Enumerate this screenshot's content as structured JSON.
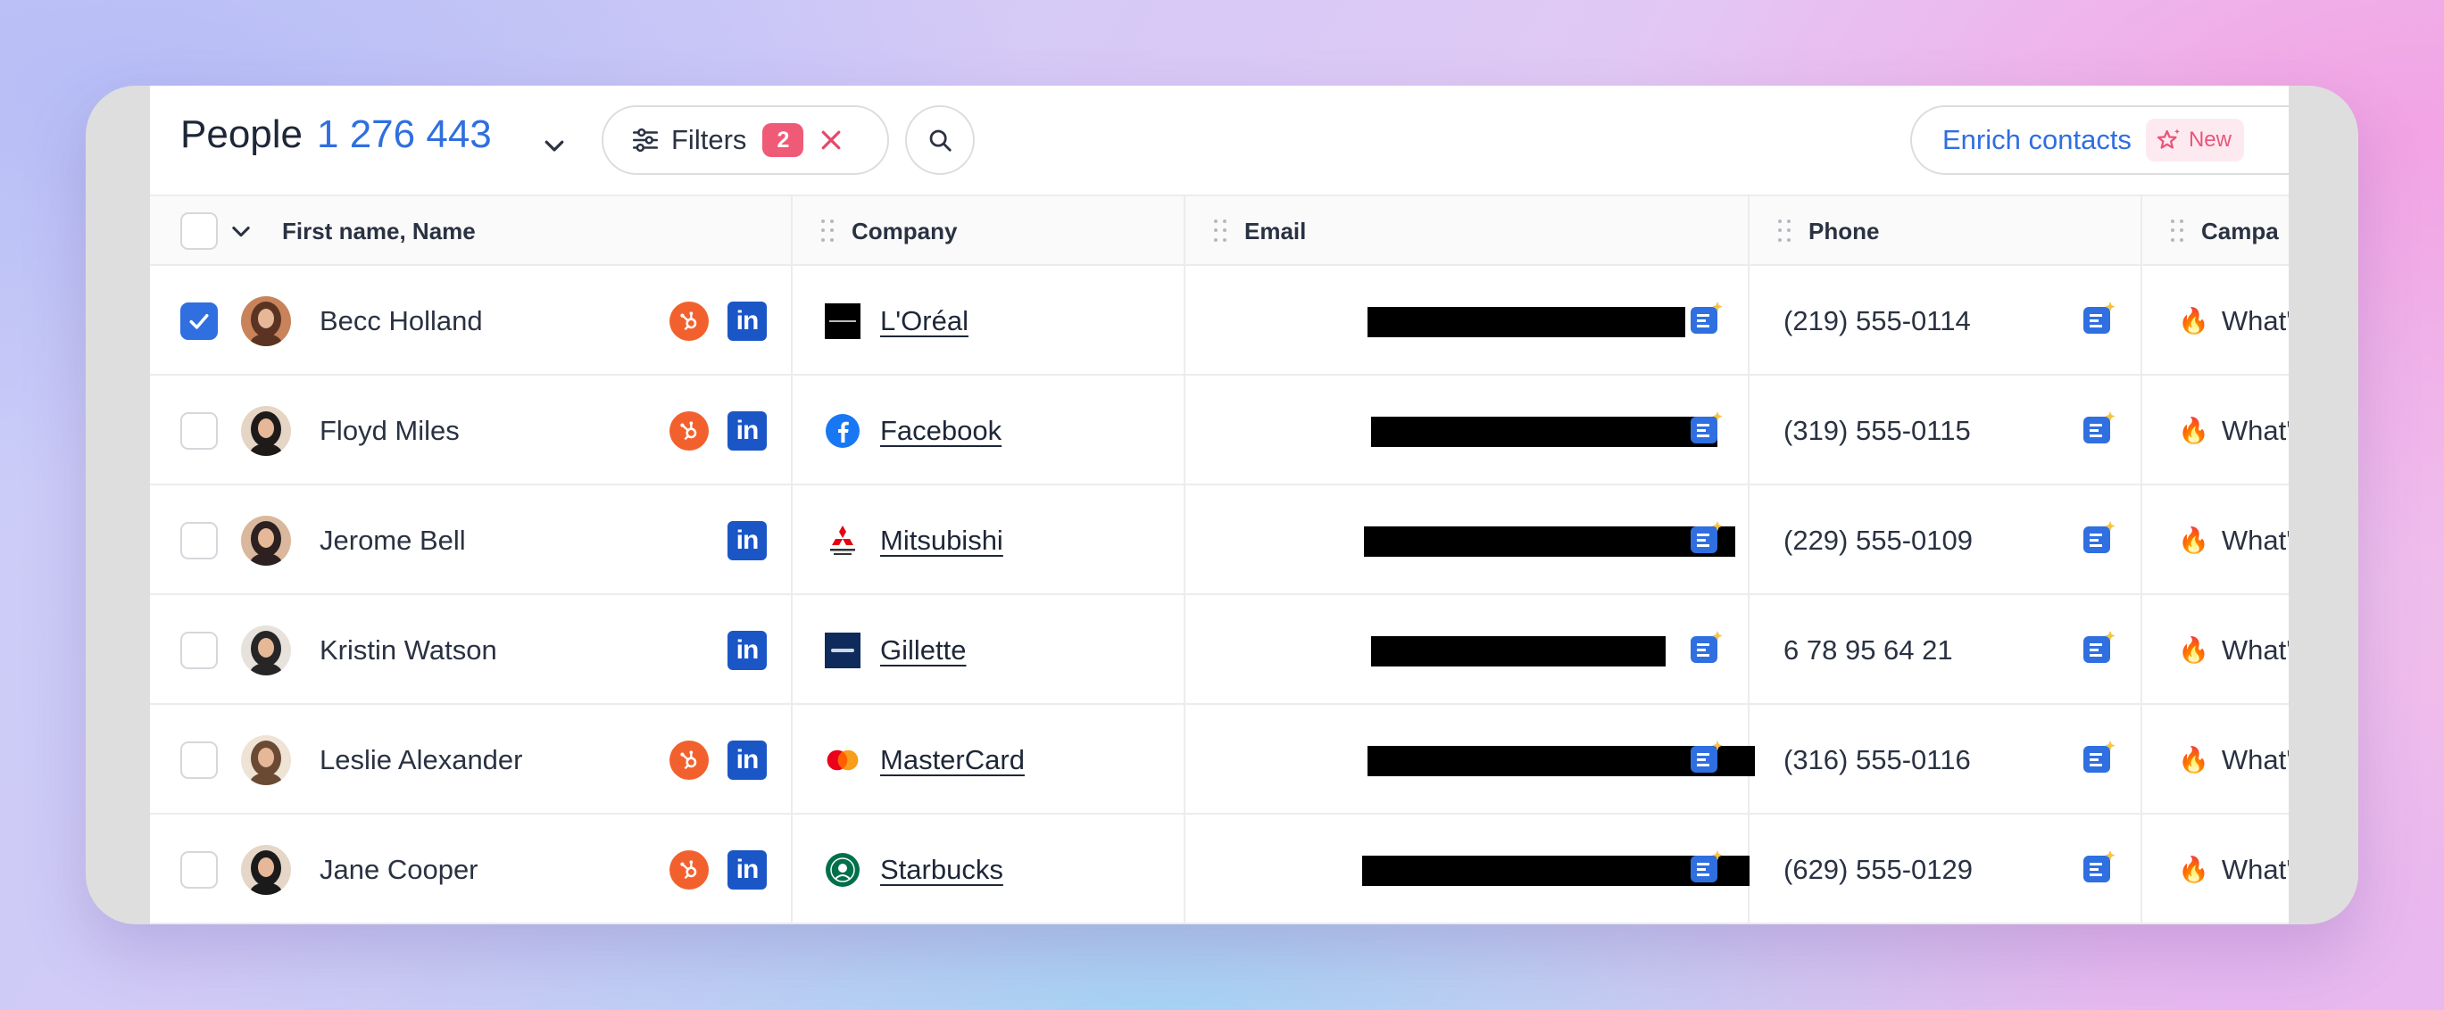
{
  "header": {
    "title": "People",
    "count": "1 276 443",
    "filters_label": "Filters",
    "filters_count": "2",
    "enrich_label": "Enrich contacts",
    "new_tag": "New"
  },
  "columns": {
    "name": "First name, Name",
    "company": "Company",
    "email": "Email",
    "phone": "Phone",
    "campaign": "Campa"
  },
  "rows": [
    {
      "name": "Becc Holland",
      "checked": true,
      "hubspot": true,
      "linkedin": true,
      "company": "L'Oréal",
      "company_logo": "loreal-logo",
      "email": "",
      "phone": "(219) 555-0114",
      "campaign": "What'"
    },
    {
      "name": "Floyd Miles",
      "checked": false,
      "hubspot": true,
      "linkedin": true,
      "company": "Facebook",
      "company_logo": "facebook-logo",
      "email": "",
      "phone": "(319) 555-0115",
      "campaign": "What'"
    },
    {
      "name": "Jerome Bell",
      "checked": false,
      "hubspot": false,
      "linkedin": true,
      "company": "Mitsubishi",
      "company_logo": "mitsubishi-logo",
      "email": "",
      "phone": "(229) 555-0109",
      "campaign": "What'"
    },
    {
      "name": "Kristin Watson",
      "checked": false,
      "hubspot": false,
      "linkedin": true,
      "company": "Gillette",
      "company_logo": "gillette-logo",
      "email": "",
      "phone": "6 78 95 64 21",
      "campaign": "What'"
    },
    {
      "name": "Leslie Alexander",
      "checked": false,
      "hubspot": true,
      "linkedin": true,
      "company": "MasterCard",
      "company_logo": "mastercard-logo",
      "email": "",
      "phone": "(316) 555-0116",
      "campaign": "What'"
    },
    {
      "name": "Jane Cooper",
      "checked": false,
      "hubspot": true,
      "linkedin": true,
      "company": "Starbucks",
      "company_logo": "starbucks-logo",
      "email": "",
      "phone": "(629) 555-0129",
      "campaign": "What'"
    }
  ],
  "colors": {
    "accent": "#2f6fe0",
    "badge": "#ef5a76",
    "hubspot": "#f2612d",
    "linkedin": "#1b56c7",
    "text": "#2a3242"
  }
}
